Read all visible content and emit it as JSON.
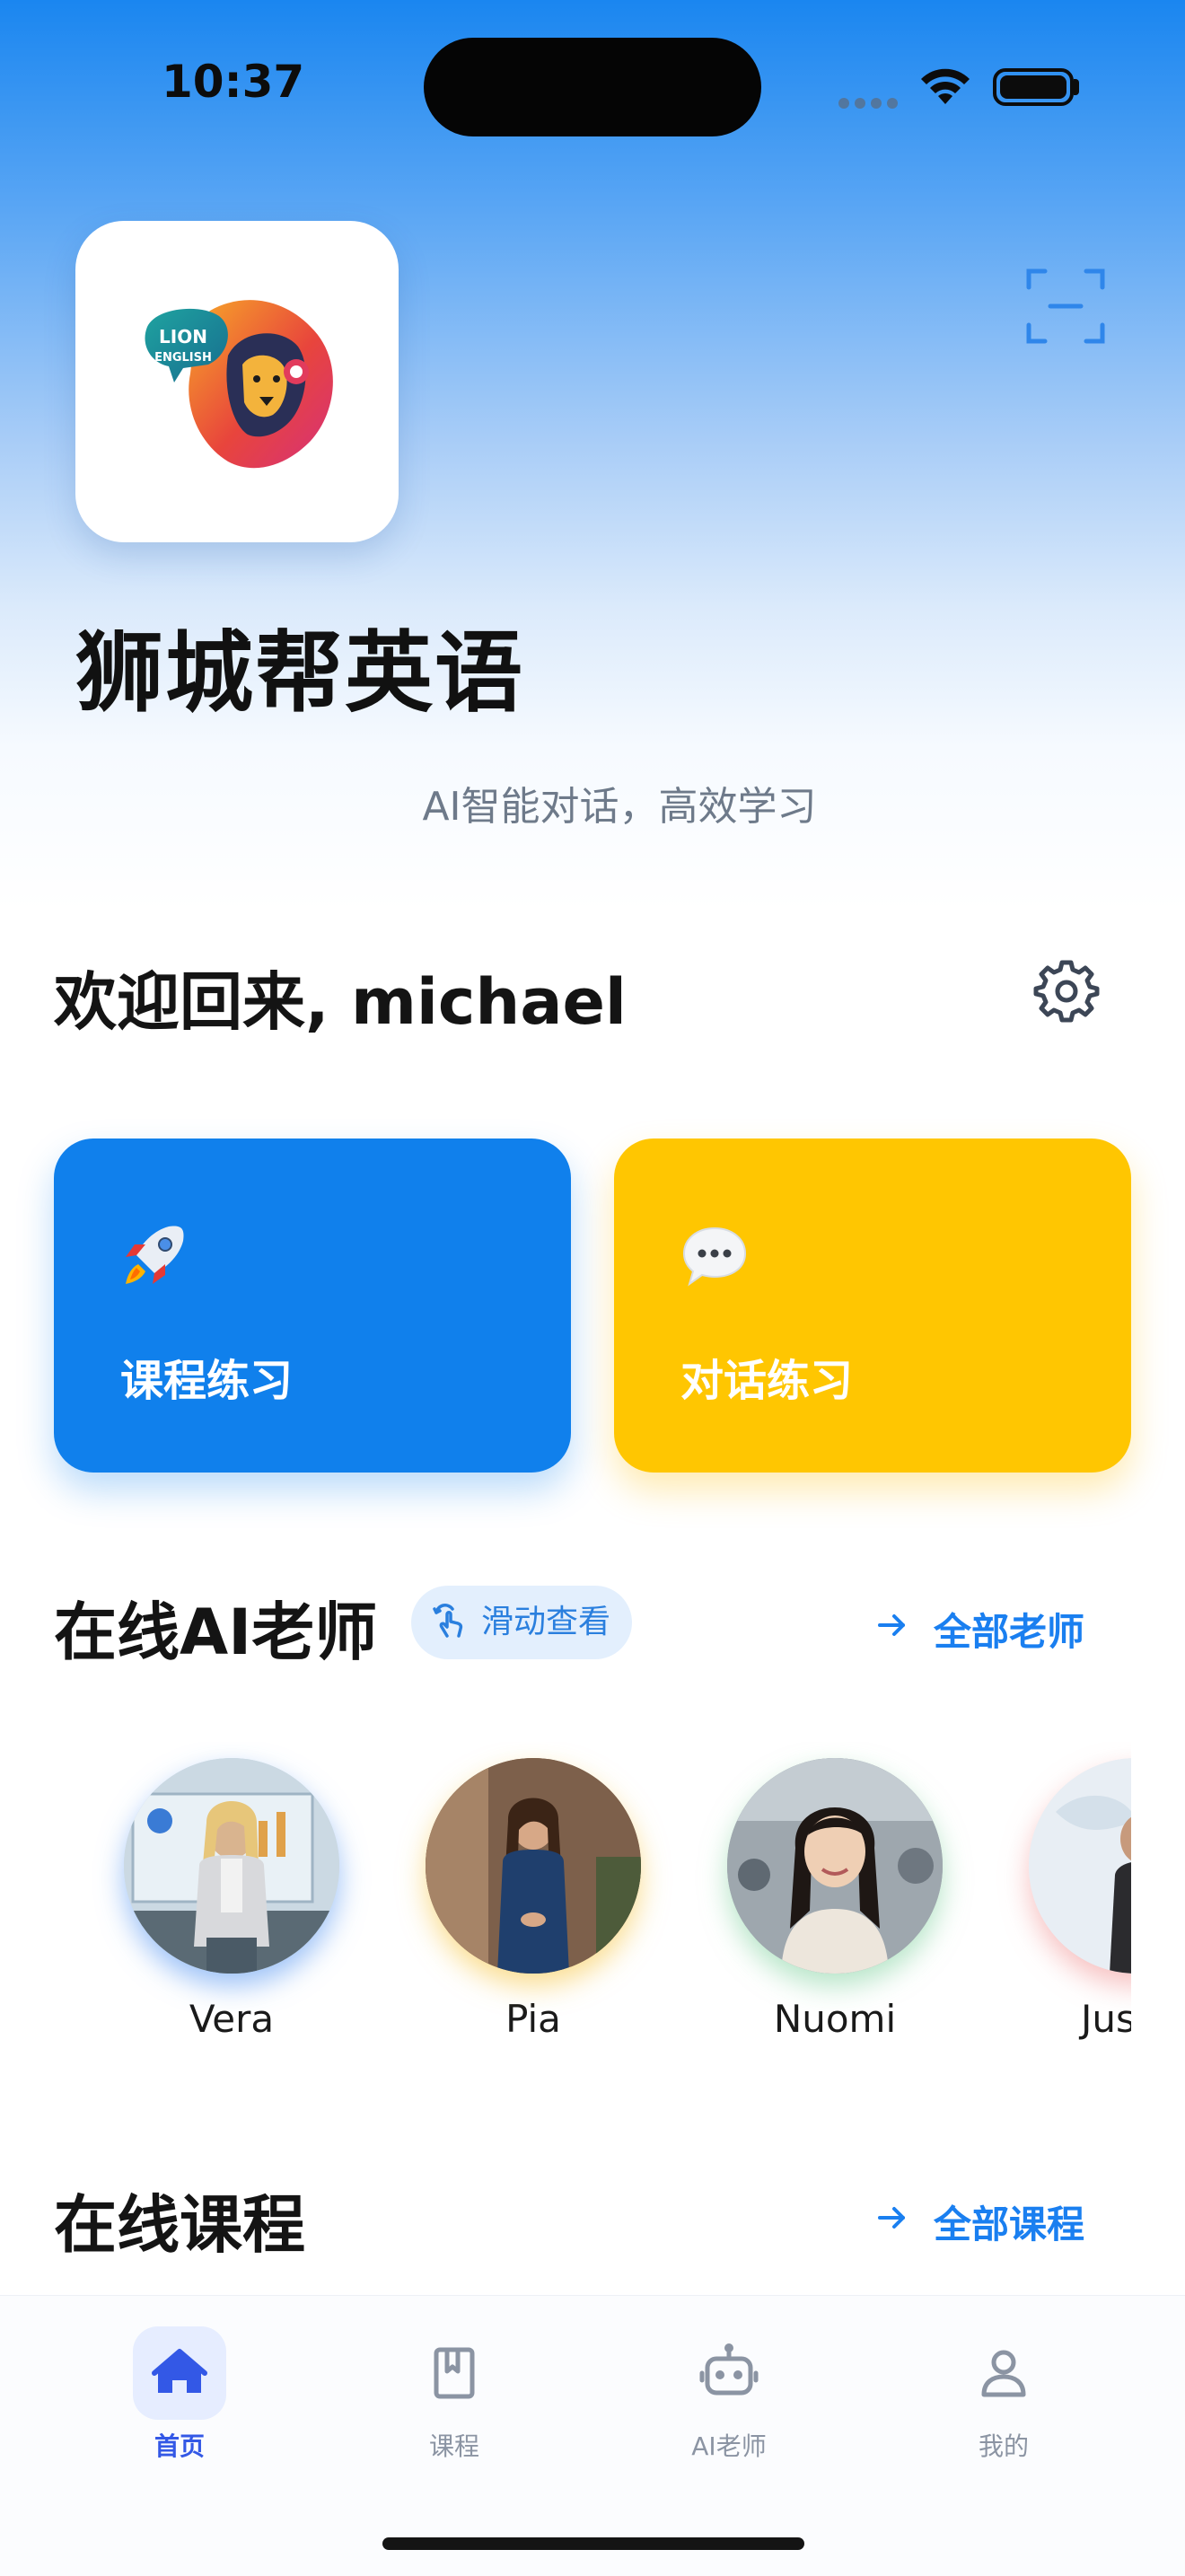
{
  "status_bar": {
    "time": "10:37"
  },
  "app": {
    "logo_text_line1": "LION",
    "logo_text_line2": "ENGLISH",
    "title": "狮城帮英语",
    "subtitle": "AI智能对话，高效学习"
  },
  "welcome": {
    "text": "欢迎回来, michael"
  },
  "actions": [
    {
      "label": "课程练习",
      "icon": "rocket-icon",
      "color": "#1080ec"
    },
    {
      "label": "对话练习",
      "icon": "speech-bubble-icon",
      "color": "#ffc601"
    }
  ],
  "teachers_section": {
    "title": "在线AI老师",
    "swipe_hint": "滑动查看",
    "see_all": "全部老师",
    "teachers": [
      {
        "name": "Vera",
        "glow": "#4d8ff0"
      },
      {
        "name": "Pia",
        "glow": "#f5c33a"
      },
      {
        "name": "Nuomi",
        "glow": "#7ccf9a"
      },
      {
        "name": "Jus",
        "glow": "#f08f8f"
      }
    ]
  },
  "courses_section": {
    "title": "在线课程",
    "see_all": "全部课程"
  },
  "tabbar": {
    "items": [
      {
        "label": "首页",
        "icon": "home-icon",
        "active": true
      },
      {
        "label": "课程",
        "icon": "book-icon",
        "active": false
      },
      {
        "label": "AI老师",
        "icon": "robot-icon",
        "active": false
      },
      {
        "label": "我的",
        "icon": "user-icon",
        "active": false
      }
    ]
  },
  "colors": {
    "accent": "#1a7ff0",
    "active_tab": "#3358e6"
  }
}
